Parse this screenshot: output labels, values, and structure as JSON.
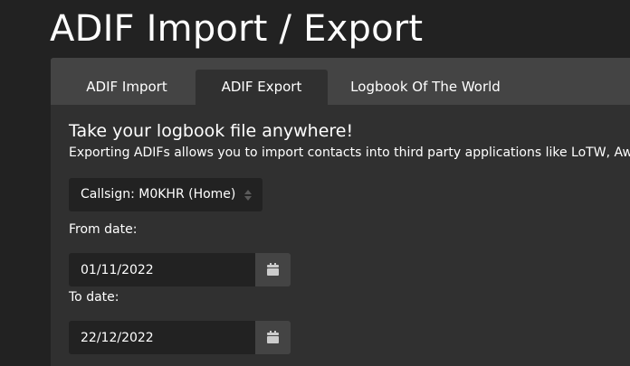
{
  "page": {
    "title": "ADIF Import / Export"
  },
  "tabs": [
    {
      "label": "ADIF Import",
      "active": false
    },
    {
      "label": "ADIF Export",
      "active": true
    },
    {
      "label": "Logbook Of The World",
      "active": false
    }
  ],
  "export": {
    "heading": "Take your logbook file anywhere!",
    "description": "Exporting ADIFs allows you to import contacts into third party applications like LoTW, Awards or just for keeping a backup.",
    "callsign_select": {
      "value": "Callsign: M0KHR (Home)"
    },
    "from_date": {
      "label": "From date:",
      "value": "01/11/2022"
    },
    "to_date": {
      "label": "To date:",
      "value": "22/12/2022"
    }
  },
  "icons": {
    "calendar": "calendar-icon",
    "select_arrows": "updown-icon"
  },
  "colors": {
    "background": "#222222",
    "card": "#303030",
    "card_header": "#444444",
    "input": "#222222",
    "addon": "#444444",
    "text": "#ffffff"
  }
}
